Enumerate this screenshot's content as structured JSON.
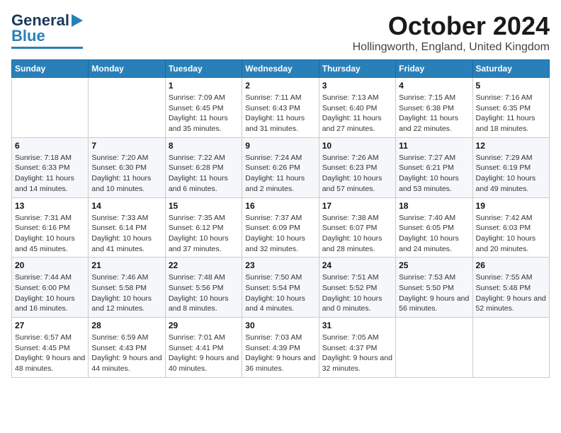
{
  "logo": {
    "line1": "General",
    "line2": "Blue"
  },
  "header": {
    "title": "October 2024",
    "subtitle": "Hollingworth, England, United Kingdom"
  },
  "weekdays": [
    "Sunday",
    "Monday",
    "Tuesday",
    "Wednesday",
    "Thursday",
    "Friday",
    "Saturday"
  ],
  "weeks": [
    [
      {
        "day": "",
        "info": ""
      },
      {
        "day": "",
        "info": ""
      },
      {
        "day": "1",
        "info": "Sunrise: 7:09 AM\nSunset: 6:45 PM\nDaylight: 11 hours and 35 minutes."
      },
      {
        "day": "2",
        "info": "Sunrise: 7:11 AM\nSunset: 6:43 PM\nDaylight: 11 hours and 31 minutes."
      },
      {
        "day": "3",
        "info": "Sunrise: 7:13 AM\nSunset: 6:40 PM\nDaylight: 11 hours and 27 minutes."
      },
      {
        "day": "4",
        "info": "Sunrise: 7:15 AM\nSunset: 6:38 PM\nDaylight: 11 hours and 22 minutes."
      },
      {
        "day": "5",
        "info": "Sunrise: 7:16 AM\nSunset: 6:35 PM\nDaylight: 11 hours and 18 minutes."
      }
    ],
    [
      {
        "day": "6",
        "info": "Sunrise: 7:18 AM\nSunset: 6:33 PM\nDaylight: 11 hours and 14 minutes."
      },
      {
        "day": "7",
        "info": "Sunrise: 7:20 AM\nSunset: 6:30 PM\nDaylight: 11 hours and 10 minutes."
      },
      {
        "day": "8",
        "info": "Sunrise: 7:22 AM\nSunset: 6:28 PM\nDaylight: 11 hours and 6 minutes."
      },
      {
        "day": "9",
        "info": "Sunrise: 7:24 AM\nSunset: 6:26 PM\nDaylight: 11 hours and 2 minutes."
      },
      {
        "day": "10",
        "info": "Sunrise: 7:26 AM\nSunset: 6:23 PM\nDaylight: 10 hours and 57 minutes."
      },
      {
        "day": "11",
        "info": "Sunrise: 7:27 AM\nSunset: 6:21 PM\nDaylight: 10 hours and 53 minutes."
      },
      {
        "day": "12",
        "info": "Sunrise: 7:29 AM\nSunset: 6:19 PM\nDaylight: 10 hours and 49 minutes."
      }
    ],
    [
      {
        "day": "13",
        "info": "Sunrise: 7:31 AM\nSunset: 6:16 PM\nDaylight: 10 hours and 45 minutes."
      },
      {
        "day": "14",
        "info": "Sunrise: 7:33 AM\nSunset: 6:14 PM\nDaylight: 10 hours and 41 minutes."
      },
      {
        "day": "15",
        "info": "Sunrise: 7:35 AM\nSunset: 6:12 PM\nDaylight: 10 hours and 37 minutes."
      },
      {
        "day": "16",
        "info": "Sunrise: 7:37 AM\nSunset: 6:09 PM\nDaylight: 10 hours and 32 minutes."
      },
      {
        "day": "17",
        "info": "Sunrise: 7:38 AM\nSunset: 6:07 PM\nDaylight: 10 hours and 28 minutes."
      },
      {
        "day": "18",
        "info": "Sunrise: 7:40 AM\nSunset: 6:05 PM\nDaylight: 10 hours and 24 minutes."
      },
      {
        "day": "19",
        "info": "Sunrise: 7:42 AM\nSunset: 6:03 PM\nDaylight: 10 hours and 20 minutes."
      }
    ],
    [
      {
        "day": "20",
        "info": "Sunrise: 7:44 AM\nSunset: 6:00 PM\nDaylight: 10 hours and 16 minutes."
      },
      {
        "day": "21",
        "info": "Sunrise: 7:46 AM\nSunset: 5:58 PM\nDaylight: 10 hours and 12 minutes."
      },
      {
        "day": "22",
        "info": "Sunrise: 7:48 AM\nSunset: 5:56 PM\nDaylight: 10 hours and 8 minutes."
      },
      {
        "day": "23",
        "info": "Sunrise: 7:50 AM\nSunset: 5:54 PM\nDaylight: 10 hours and 4 minutes."
      },
      {
        "day": "24",
        "info": "Sunrise: 7:51 AM\nSunset: 5:52 PM\nDaylight: 10 hours and 0 minutes."
      },
      {
        "day": "25",
        "info": "Sunrise: 7:53 AM\nSunset: 5:50 PM\nDaylight: 9 hours and 56 minutes."
      },
      {
        "day": "26",
        "info": "Sunrise: 7:55 AM\nSunset: 5:48 PM\nDaylight: 9 hours and 52 minutes."
      }
    ],
    [
      {
        "day": "27",
        "info": "Sunrise: 6:57 AM\nSunset: 4:45 PM\nDaylight: 9 hours and 48 minutes."
      },
      {
        "day": "28",
        "info": "Sunrise: 6:59 AM\nSunset: 4:43 PM\nDaylight: 9 hours and 44 minutes."
      },
      {
        "day": "29",
        "info": "Sunrise: 7:01 AM\nSunset: 4:41 PM\nDaylight: 9 hours and 40 minutes."
      },
      {
        "day": "30",
        "info": "Sunrise: 7:03 AM\nSunset: 4:39 PM\nDaylight: 9 hours and 36 minutes."
      },
      {
        "day": "31",
        "info": "Sunrise: 7:05 AM\nSunset: 4:37 PM\nDaylight: 9 hours and 32 minutes."
      },
      {
        "day": "",
        "info": ""
      },
      {
        "day": "",
        "info": ""
      }
    ]
  ]
}
